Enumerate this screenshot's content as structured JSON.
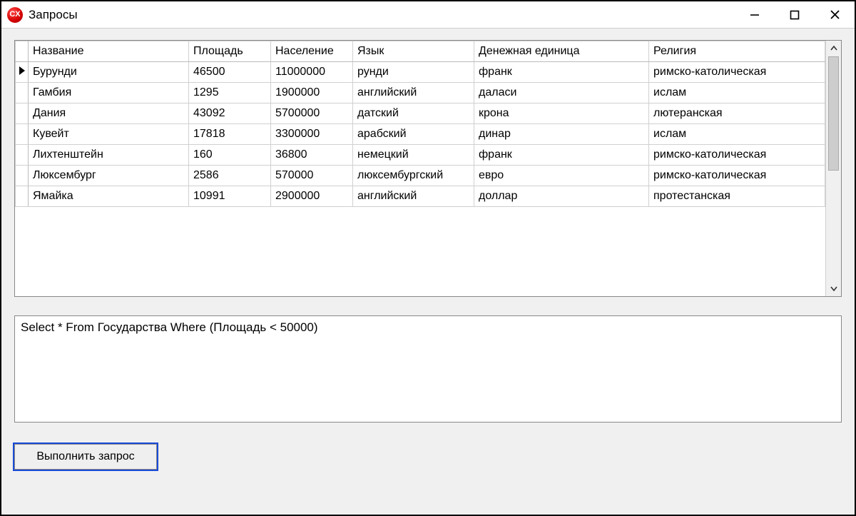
{
  "window": {
    "title": "Запросы",
    "icon_letters": "CX"
  },
  "grid": {
    "headers": {
      "name": "Название",
      "area": "Площадь",
      "population": "Население",
      "language": "Язык",
      "currency": "Денежная единица",
      "religion": "Религия"
    },
    "rows": [
      {
        "name": "Бурунди",
        "area": "46500",
        "population": "11000000",
        "language": "рунди",
        "currency": "франк",
        "religion": "римско-католическая",
        "current": true
      },
      {
        "name": "Гамбия",
        "area": "1295",
        "population": "1900000",
        "language": "английский",
        "currency": "даласи",
        "religion": "ислам",
        "current": false
      },
      {
        "name": "Дания",
        "area": "43092",
        "population": "5700000",
        "language": "датский",
        "currency": "крона",
        "religion": "лютеранская",
        "current": false
      },
      {
        "name": "Кувейт",
        "area": "17818",
        "population": "3300000",
        "language": "арабский",
        "currency": "динар",
        "religion": "ислам",
        "current": false
      },
      {
        "name": "Лихтенштейн",
        "area": "160",
        "population": "36800",
        "language": "немецкий",
        "currency": "франк",
        "religion": "римско-католическая",
        "current": false
      },
      {
        "name": "Люксембург",
        "area": "2586",
        "population": "570000",
        "language": "люксембургский",
        "currency": "евро",
        "religion": "римско-католическая",
        "current": false
      },
      {
        "name": "Ямайка",
        "area": "10991",
        "population": "2900000",
        "language": "английский",
        "currency": "доллар",
        "religion": "протестанская",
        "current": false
      }
    ]
  },
  "query": {
    "text": "Select * From Государства Where (Площадь < 50000)"
  },
  "buttons": {
    "run_query": "Выполнить запрос"
  }
}
